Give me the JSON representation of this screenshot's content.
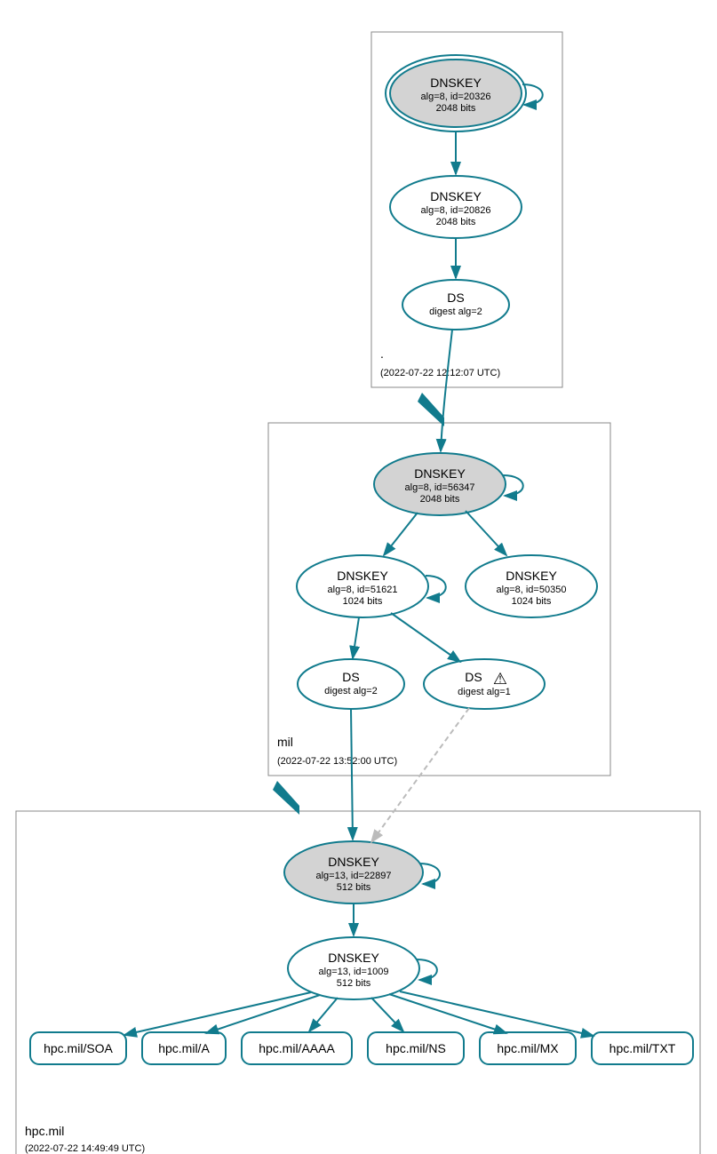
{
  "zones": {
    "root": {
      "label": ".",
      "time": "(2022-07-22 12:12:07 UTC)"
    },
    "mil": {
      "label": "mil",
      "time": "(2022-07-22 13:52:00 UTC)"
    },
    "hpc": {
      "label": "hpc.mil",
      "time": "(2022-07-22 14:49:49 UTC)"
    }
  },
  "nodes": {
    "root_ksk": {
      "title": "DNSKEY",
      "alg": "alg=8, id=20326",
      "bits": "2048 bits"
    },
    "root_zsk": {
      "title": "DNSKEY",
      "alg": "alg=8, id=20826",
      "bits": "2048 bits"
    },
    "root_ds": {
      "title": "DS",
      "alg": "digest alg=2"
    },
    "mil_ksk": {
      "title": "DNSKEY",
      "alg": "alg=8, id=56347",
      "bits": "2048 bits"
    },
    "mil_zsk1": {
      "title": "DNSKEY",
      "alg": "alg=8, id=51621",
      "bits": "1024 bits"
    },
    "mil_zsk2": {
      "title": "DNSKEY",
      "alg": "alg=8, id=50350",
      "bits": "1024 bits"
    },
    "mil_ds2": {
      "title": "DS",
      "alg": "digest alg=2"
    },
    "mil_ds1": {
      "title": "DS",
      "alg": "digest alg=1"
    },
    "hpc_ksk": {
      "title": "DNSKEY",
      "alg": "alg=13, id=22897",
      "bits": "512 bits"
    },
    "hpc_zsk": {
      "title": "DNSKEY",
      "alg": "alg=13, id=1009",
      "bits": "512 bits"
    }
  },
  "rrsets": {
    "soa": "hpc.mil/SOA",
    "a": "hpc.mil/A",
    "aaaa": "hpc.mil/AAAA",
    "ns": "hpc.mil/NS",
    "mx": "hpc.mil/MX",
    "txt": "hpc.mil/TXT"
  },
  "warning_icon": "⚠"
}
